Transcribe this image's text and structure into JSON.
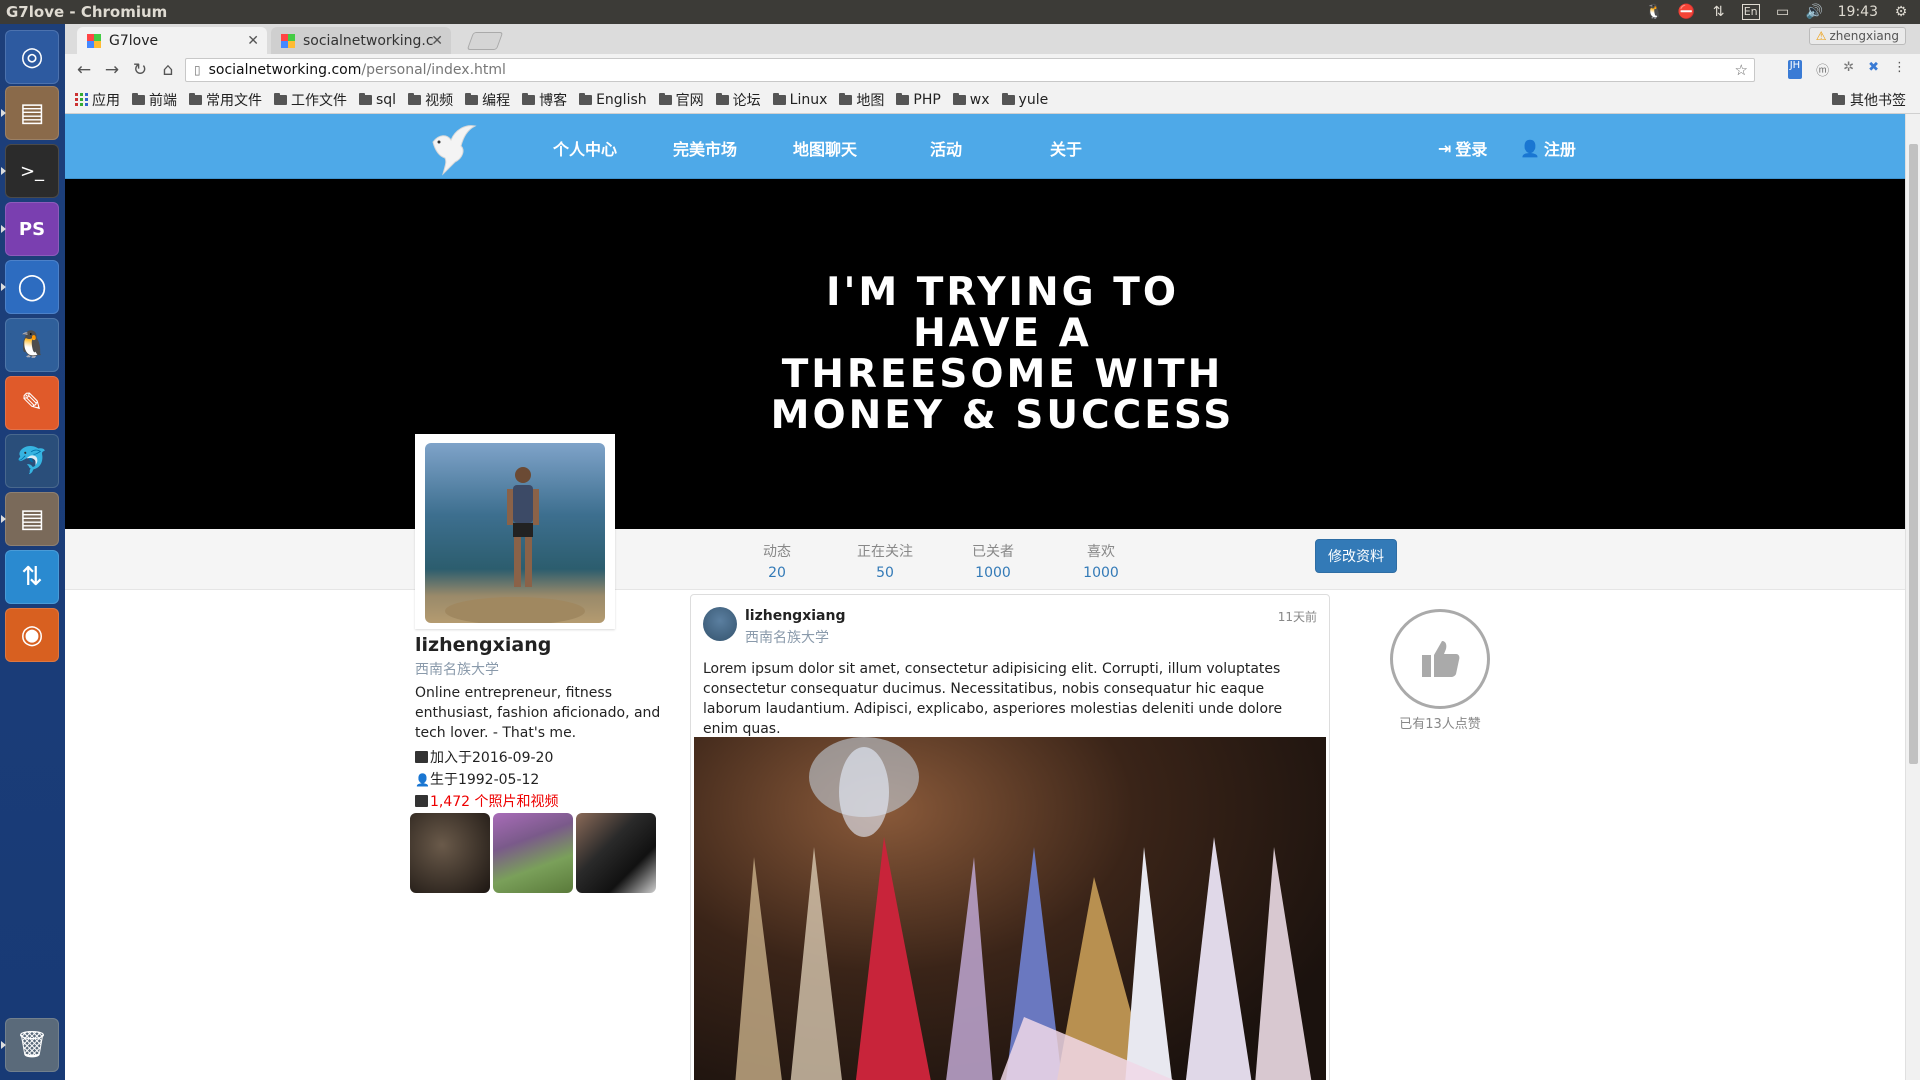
{
  "os": {
    "window_title": "G7love - Chromium",
    "clock": "19:43",
    "input_method": "En",
    "user": "zhengxiang"
  },
  "browser": {
    "tabs": [
      {
        "label": "G7love",
        "active": true
      },
      {
        "label": "socialnetworking.c",
        "active": false
      }
    ],
    "url_host": "socialnetworking.com",
    "url_path": "/personal/index.html",
    "bookmarks": [
      "应用",
      "前端",
      "常用文件",
      "工作文件",
      "sql",
      "视频",
      "编程",
      "博客",
      "English",
      "官网",
      "论坛",
      "Linux",
      "地图",
      "PHP",
      "wx",
      "yule"
    ],
    "other_bookmarks": "其他书签",
    "ext_badge": "JH"
  },
  "site": {
    "nav": [
      "个人中心",
      "完美市场",
      "地图聊天",
      "活动",
      "关于"
    ],
    "login": "登录",
    "register": "注册",
    "banner_lines": [
      "I'M TRYING TO",
      "HAVE A",
      "THREESOME WITH",
      "MONEY & SUCCESS"
    ],
    "stats": [
      {
        "label": "动态",
        "value": "20"
      },
      {
        "label": "正在关注",
        "value": "50"
      },
      {
        "label": "已关者",
        "value": "1000"
      },
      {
        "label": "喜欢",
        "value": "1000"
      }
    ],
    "edit_button": "修改资料",
    "profile": {
      "name": "lizhengxiang",
      "school": "西南名族大学",
      "bio": "Online entrepreneur, fitness enthusiast, fashion aficionado, and tech lover. - That's me.",
      "joined": "加入于2016-09-20",
      "born": "生于1992-05-12",
      "media": "1,472 个照片和视频"
    },
    "post": {
      "user": "lizhengxiang",
      "school": "西南名族大学",
      "time": "11天前",
      "body": "Lorem ipsum dolor sit amet, consectetur adipisicing elit. Corrupti, illum voluptates consectetur consequatur ducimus. Necessitatibus, nobis consequatur hic eaque laborum laudantium. Adipisci, explicabo, asperiores molestias deleniti unde dolore enim quas."
    },
    "likes_text": "已有13人点赞"
  },
  "colors": {
    "nav_blue": "#4ea9e8",
    "link_blue": "#337ab7",
    "media_red": "#e00000"
  }
}
